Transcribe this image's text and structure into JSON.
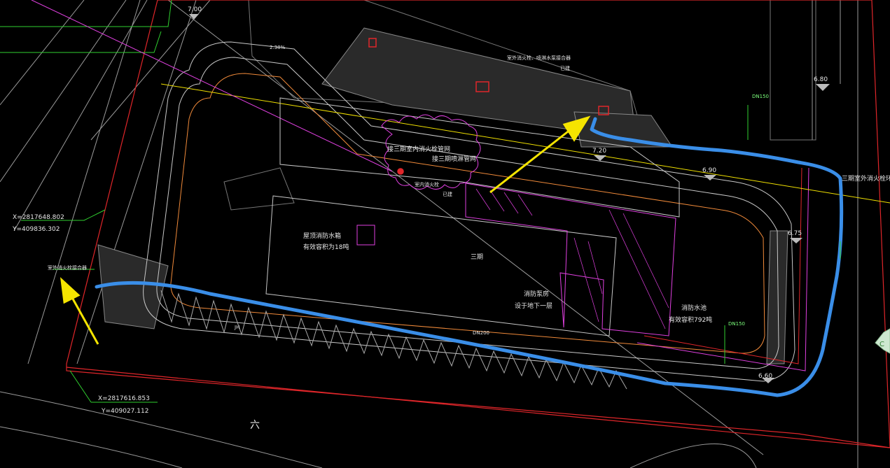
{
  "drawing": {
    "coordinates": [
      {
        "x": "X=2817648.802",
        "y": "Y=409836.302"
      },
      {
        "x": "X=2817616.853",
        "y": "Y=409027.112"
      }
    ],
    "labels": {
      "roof_tank": "屋顶消防水箱",
      "roof_tank_volume": "有效容积为18吨",
      "pump_room": "消防泵房",
      "pump_room_location": "设于地下一层",
      "pool": "消防水池",
      "pool_volume": "有效容积792吨",
      "phase": "三期",
      "block_six": "六",
      "connect_hydrant_net": "接三期室内消火栓管网",
      "connect_spray_net": "接三期喷淋管网",
      "outdoor_loop": "三期室外消火栓环网",
      "adapter_top": "室外消火栓、喷淋水泵接合器",
      "built_top": "已建",
      "indoor_riser": "室内消火栓",
      "built_mid": "已建",
      "adapter_left": "室外消火栓接合器",
      "pipe_dn150": "DN150",
      "pipe_dn200": "DN200",
      "pipe_jh": "JH",
      "note_2m": "2.38%"
    },
    "elevations": [
      "7.00",
      "6.80",
      "7.20",
      "6.90",
      "6.75",
      "6.60"
    ],
    "colors": {
      "background": "#000000",
      "boundary_red": "#e0262a",
      "magenta": "#e040e0",
      "yellow": "#f0e000",
      "green": "#30d030",
      "blue_route": "#3a8ee8",
      "arrow": "#f5e400",
      "grey": "#b0b0b0"
    }
  }
}
